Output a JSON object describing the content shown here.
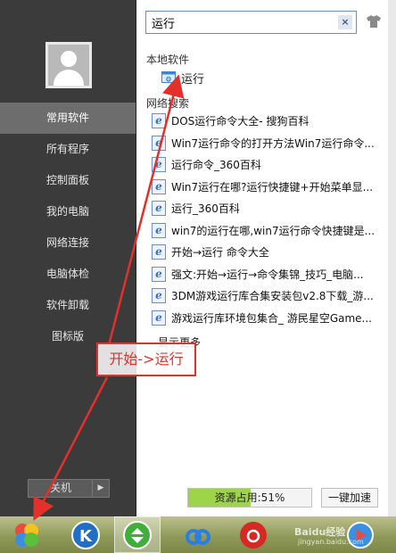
{
  "sidebar": {
    "items": [
      {
        "label": "常用软件",
        "active": true
      },
      {
        "label": "所有程序",
        "active": false
      },
      {
        "label": "控制面板",
        "active": false
      },
      {
        "label": "我的电脑",
        "active": false
      },
      {
        "label": "网络连接",
        "active": false
      },
      {
        "label": "电脑体检",
        "active": false
      },
      {
        "label": "软件卸载",
        "active": false
      },
      {
        "label": "图标版",
        "active": false
      }
    ],
    "shutdown_label": "关机",
    "shutdown_arrow": "▶"
  },
  "search": {
    "value": "运行",
    "clear_label": "×"
  },
  "local": {
    "title": "本地软件",
    "item": "运行"
  },
  "web": {
    "title": "网络搜索",
    "results": [
      "DOS运行命令大全- 搜狗百科",
      "Win7运行命令的打开方法Win7运行命令...",
      "运行命令_360百科",
      "Win7运行在哪?运行快捷键+开始菜单显...",
      "运行_360百科",
      "win7的运行在哪,win7运行命令快捷键是...",
      "开始→运行 命令大全",
      "强文:开始→运行→命令集锦_技巧_电脑...",
      "3DM游戏运行库合集安装包v2.8下载_游...",
      "游戏运行库环境包集合_ 游民星空Game..."
    ],
    "result_icon": "e",
    "more_label": "显示更多"
  },
  "footer": {
    "usage_label": "资源占用:51%",
    "usage_fraction": 0.51,
    "speedup_label": "一键加速"
  },
  "annotation": {
    "text": "开始->运行",
    "color": "#e3302a"
  },
  "watermark": {
    "line1": "Baidu经验",
    "line2": "jingyan.baidu.com"
  },
  "icons": {
    "taskbar": [
      "start-orb-icon",
      "kuaibo-k-icon",
      "green-circle-arrow-icon",
      "baidu-cloud-icon",
      "netease-music-icon",
      "browser-icon"
    ]
  }
}
